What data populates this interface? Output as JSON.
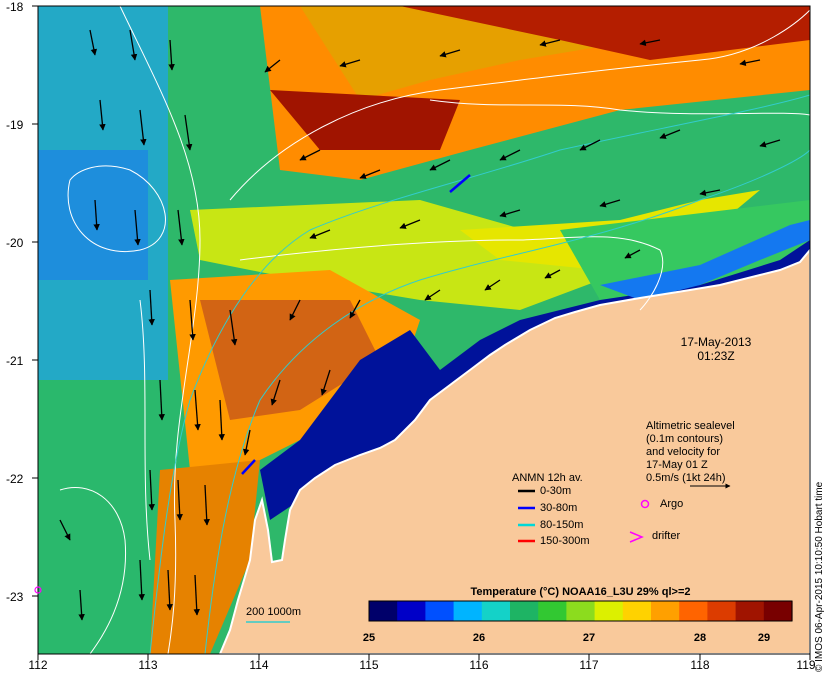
{
  "map": {
    "date": "17-May-2013",
    "time": "01:23Z",
    "lon_ticks": [
      "112",
      "113",
      "114",
      "115",
      "116",
      "117",
      "118",
      "119"
    ],
    "lat_ticks": [
      "-18",
      "-19",
      "-20",
      "-21",
      "-22",
      "-23"
    ],
    "land_color": "#f9c99b",
    "coast_color": "#ffffff"
  },
  "altimetry_note": {
    "line1": "Altimetric sealevel",
    "line2": "(0.1m contours)",
    "line3": "and velocity for",
    "line4": "17-May 01 Z",
    "line5": "0.5m/s (1kt 24h)"
  },
  "anmn_legend": {
    "title": "ANMN 12h av.",
    "items": [
      {
        "label": "0-30m",
        "color": "#000000"
      },
      {
        "label": "30-80m",
        "color": "#0000ff"
      },
      {
        "label": "80-150m",
        "color": "#00d8d8"
      },
      {
        "label": "150-300m",
        "color": "#ff0000"
      }
    ]
  },
  "markers": {
    "argo": "Argo",
    "drifter": "drifter",
    "marker_color": "#ff00ff"
  },
  "isobath": {
    "label": "200  1000m"
  },
  "colorbar": {
    "title": "Temperature (°C) NOAA16_L3U 29% ql>=2",
    "ticks": [
      "25",
      "26",
      "27",
      "28",
      "29"
    ],
    "colors": [
      "#00006a",
      "#0000c8",
      "#0050ff",
      "#00b4ff",
      "#14d2c8",
      "#1eb464",
      "#32c832",
      "#8cdc1e",
      "#dcf000",
      "#ffd200",
      "#ffa000",
      "#ff6400",
      "#dc3c00",
      "#a01400",
      "#780000"
    ]
  },
  "credit": "© IMOS 06-Apr-2015 10:10:50 Hobart time"
}
